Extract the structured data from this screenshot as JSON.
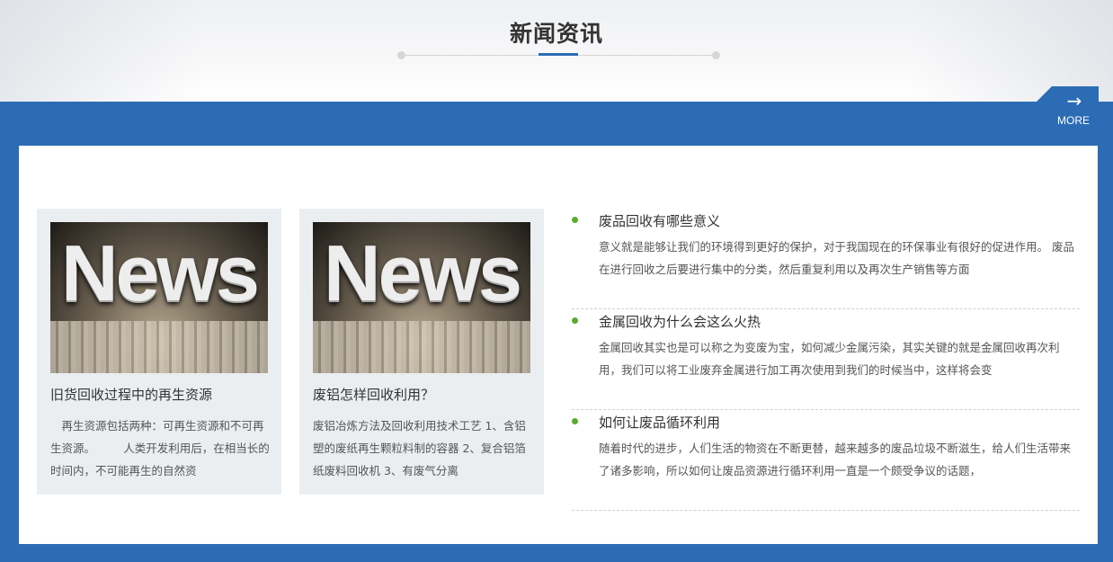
{
  "section": {
    "title": "新闻资讯"
  },
  "more": {
    "arrow": "→",
    "label": "MORE"
  },
  "cards": [
    {
      "image_text": "News",
      "title": "旧货回收过程中的再生资源",
      "summary": "　再生资源包括两种：可再生资源和不可再生资源。　　　人类开发利用后，在相当长的时间内，不可能再生的自然资"
    },
    {
      "image_text": "News",
      "title": "废铝怎样回收利用？",
      "summary": "废铝冶炼方法及回收利用技术工艺 1、含铝塑的废纸再生颗粒料制的容器 2、复合铝箔纸废料回收机 3、有废气分离"
    }
  ],
  "news": [
    {
      "title": "废品回收有哪些意义",
      "summary": "意义就是能够让我们的环境得到更好的保护，对于我国现在的环保事业有很好的促进作用。 废品在进行回收之后要进行集中的分类，然后重复利用以及再次生产销售等方面"
    },
    {
      "title": "金属回收为什么会这么火热",
      "summary": "金属回收其实也是可以称之为变废为宝，如何减少金属污染，其实关键的就是金属回收再次利用，我们可以将工业废弃金属进行加工再次使用到我们的时候当中，这样将会变"
    },
    {
      "title": "如何让废品循环利用",
      "summary": "随着时代的进步，人们生活的物资在不断更替，越来越多的废品垃圾不断滋生，给人们生活带来了诸多影响，所以如何让废品资源进行循环利用一直是一个颇受争议的话题，"
    }
  ],
  "colors": {
    "accent": "#2b6cb5",
    "bullet": "#5bab2d",
    "card_bg": "#ebeef1"
  }
}
